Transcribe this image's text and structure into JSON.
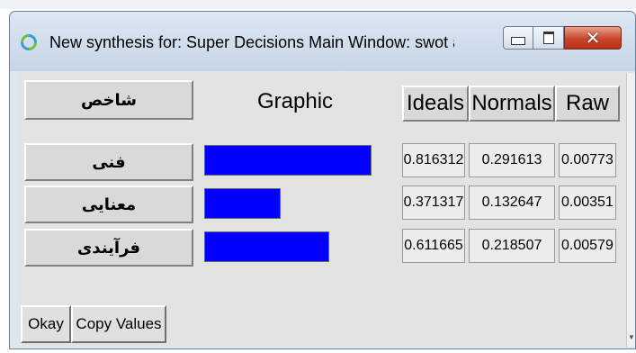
{
  "window": {
    "title": "New synthesis for: Super Decisions Main Window: swot anp i...",
    "icon": "refresh-icon",
    "buttons": {
      "minimize": "minimize-icon",
      "maximize": "maximize-icon",
      "close": "close-icon"
    }
  },
  "table": {
    "headers": {
      "name": "شاخص",
      "graphic": "Graphic",
      "ideals": "Ideals",
      "normals": "Normals",
      "raw": "Raw"
    },
    "rows": [
      {
        "name": "فنی",
        "ideal": "0.816312",
        "normal": "0.291613",
        "raw": "0.00773",
        "bar_fraction": 0.816312
      },
      {
        "name": "معنایی",
        "ideal": "0.371317",
        "normal": "0.132647",
        "raw": "0.00351",
        "bar_fraction": 0.371317
      },
      {
        "name": "فرآیندی",
        "ideal": "0.611665",
        "normal": "0.218507",
        "raw": "0.00579",
        "bar_fraction": 0.611665
      }
    ]
  },
  "footer": {
    "okay_label": "Okay",
    "copy_label": "Copy Values"
  },
  "colors": {
    "bar": "#0000ff",
    "close_button": "#c8452b",
    "titlebar": "#cfdcec"
  }
}
